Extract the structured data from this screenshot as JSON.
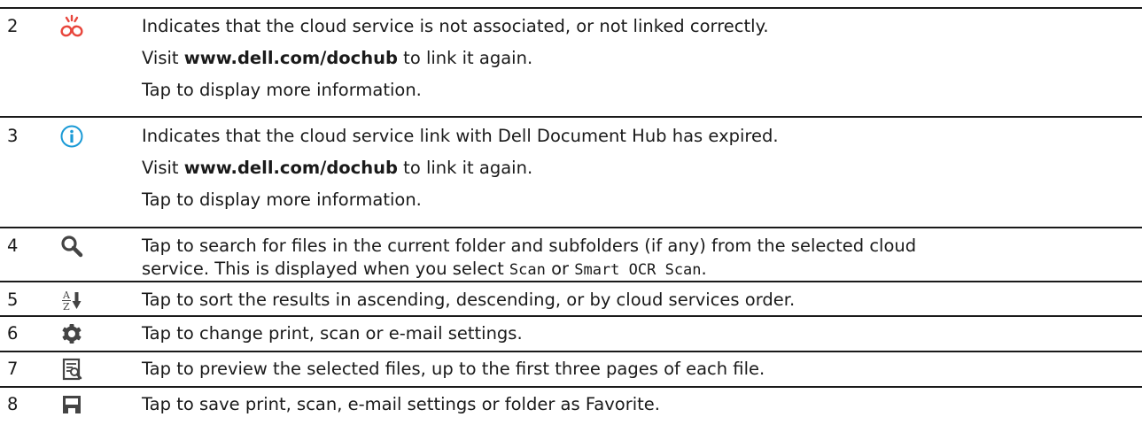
{
  "rows": [
    {
      "num": "2",
      "icon": "broken-link-icon",
      "lines": [
        "Indicates that the cloud service is not associated, or not linked correctly.",
        {
          "pre": "Visit ",
          "bold": "www.dell.com/dochub",
          "post": " to link it again."
        },
        "Tap to display more information."
      ]
    },
    {
      "num": "3",
      "icon": "info-circle-icon",
      "lines": [
        "Indicates that the cloud service link with Dell Document Hub has expired.",
        {
          "pre": "Visit ",
          "bold": "www.dell.com/dochub",
          "post": " to link it again."
        },
        "Tap to display more information."
      ]
    },
    {
      "num": "4",
      "icon": "search-icon",
      "text_line1": "Tap to search for files in the current folder and subfolders (if any) from the selected cloud",
      "text_line2_pre": "service. This is displayed when you select ",
      "code1": "Scan",
      "text_line2_mid": " or ",
      "code2": "Smart OCR Scan",
      "text_line2_post": "."
    },
    {
      "num": "5",
      "icon": "sort-az-icon",
      "text": "Tap to sort the results in ascending, descending, or by cloud services order."
    },
    {
      "num": "6",
      "icon": "gear-icon",
      "text": "Tap to change print, scan or e-mail settings."
    },
    {
      "num": "7",
      "icon": "preview-icon",
      "text": "Tap to preview the selected files, up to the first three pages of each file."
    },
    {
      "num": "8",
      "icon": "save-icon",
      "text": "Tap to save print, scan, e-mail settings or folder as Favorite."
    }
  ],
  "colors": {
    "broken_link": "#e8463c",
    "info": "#1a9ad6",
    "icon_dark": "#444444",
    "rule": "#1a1a1a"
  }
}
